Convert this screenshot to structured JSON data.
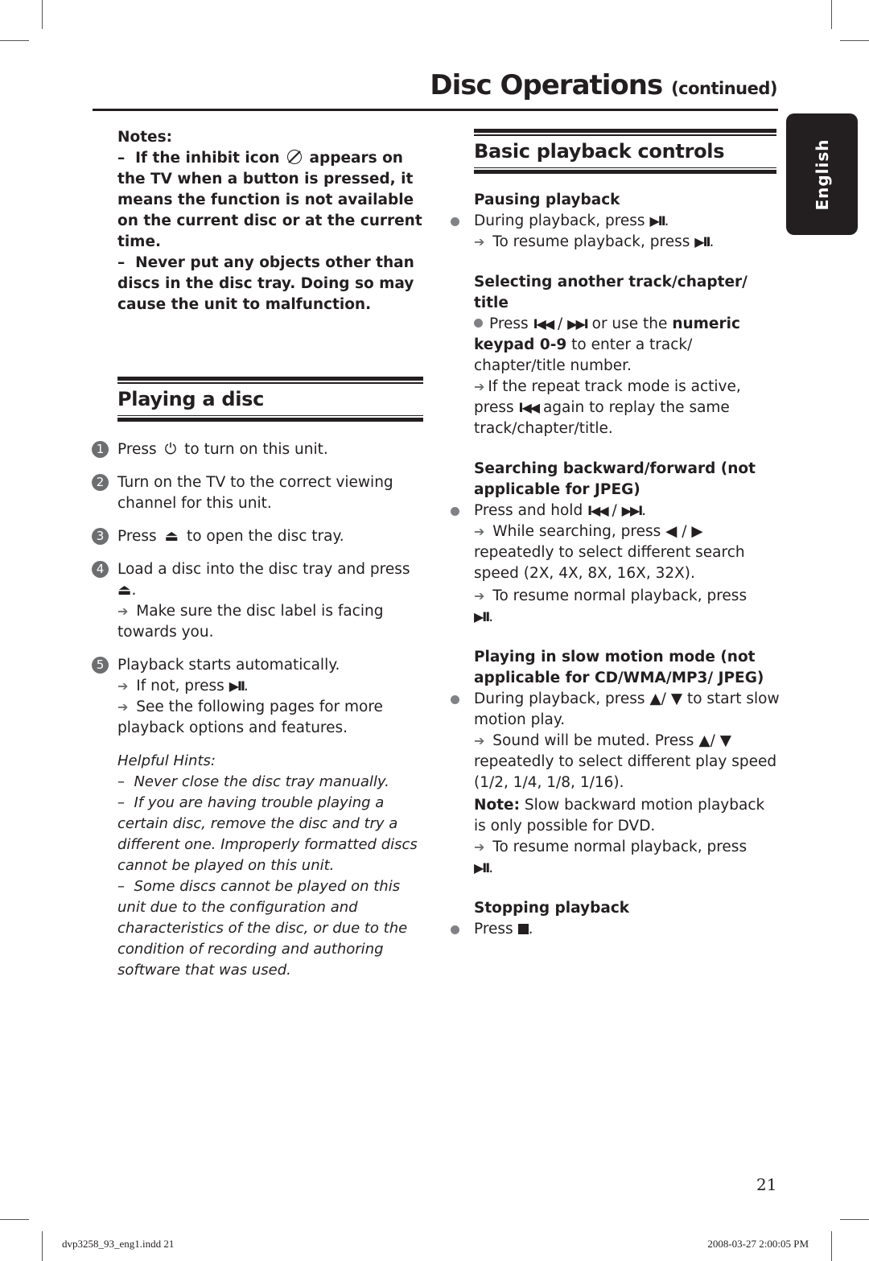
{
  "header": {
    "title": "Disc Operations",
    "title_suffix": "(continued)"
  },
  "language_tab": "English",
  "notes": {
    "label": "Notes:",
    "items": [
      {
        "dash": "–",
        "before_icon": "If the inhibit icon",
        "icon": "inhibit-icon",
        "after_icon": "appears on the TV when a button is pressed, it means the function is not available on the current disc or at the current time."
      },
      {
        "dash": "–",
        "text": "Never put any objects other than discs in the disc tray. Doing so may cause the unit to malfunction."
      }
    ]
  },
  "playing_disc": {
    "heading": "Playing a disc",
    "steps": [
      {
        "num": "1",
        "before": "Press",
        "icon": "power-icon",
        "after": "to turn on this unit."
      },
      {
        "num": "2",
        "text": "Turn on the TV to the correct viewing channel for this unit."
      },
      {
        "num": "3",
        "before": "Press",
        "icon": "eject-icon",
        "after": "to open the disc tray."
      },
      {
        "num": "4",
        "before": "Load a disc into the disc tray and press",
        "icon": "eject-icon",
        "after": ".",
        "result": "Make sure the disc label is facing towards you."
      },
      {
        "num": "5",
        "text": "Playback starts automatically.",
        "result1_before": "If not, press",
        "result1_icon": "play-pause-icon",
        "result1_after": ".",
        "result2": "See the following pages for more playback options and features."
      }
    ]
  },
  "helpful_hints": {
    "label": "Helpful Hints:",
    "items": [
      "Never close the disc tray manually.",
      "If you are having trouble playing a certain disc, remove the disc and try a different one. Improperly formatted discs cannot be played on this unit.",
      "Some discs cannot be played on this unit due to the configuration and characteristics of the disc, or due to the condition of recording and authoring software that was used."
    ]
  },
  "basic_controls": {
    "heading": "Basic playback controls",
    "pausing": {
      "title": "Pausing playback",
      "bullet_before": "During playback, press",
      "result_before": "To resume playback, press"
    },
    "selecting": {
      "title": "Selecting another track/chapter/ title",
      "bullet_before": "Press",
      "bullet_mid": "or use the",
      "bullet_bold": "numeric keypad 0-9",
      "bullet_after": "to enter a track/ chapter/title number.",
      "result_before": "If the repeat track mode is active, press",
      "result_after": "again to replay the same track/chapter/title."
    },
    "searching": {
      "title": "Searching backward/forward (not applicable for JPEG)",
      "bullet_before": "Press and hold",
      "result1_before": "While searching, press",
      "result1_after": "repeatedly to select different search speed (2X, 4X, 8X, 16X, 32X).",
      "result2_before": "To resume normal playback, press"
    },
    "slow_motion": {
      "title": "Playing in slow motion mode (not applicable for CD/WMA/MP3/ JPEG)",
      "bullet_before": "During playback, press",
      "bullet_after": "to start slow motion play.",
      "result1_before": "Sound will be muted. Press",
      "result1_after": "repeatedly to select different play speed (1/2, 1/4, 1/8, 1/16).",
      "note_label": "Note:",
      "note_text": "Slow backward motion playback is only possible for DVD.",
      "result2_before": "To resume normal playback, press"
    },
    "stopping": {
      "title": "Stopping playback",
      "bullet_before": "Press"
    }
  },
  "symbols": {
    "arrow": "➔",
    "play_pause": "▶II",
    "prev": "I◀◀",
    "next": "▶▶I",
    "slash": "/",
    "left": "◀",
    "right": "▶",
    "up": "▲/",
    "down": "▼",
    "eject": "⏏",
    "power": "⏻",
    "period": "."
  },
  "footer": {
    "page_number": "21",
    "file_name": "dvp3258_93_eng1.indd   21",
    "timestamp": "2008-03-27   2:00:05 PM"
  }
}
